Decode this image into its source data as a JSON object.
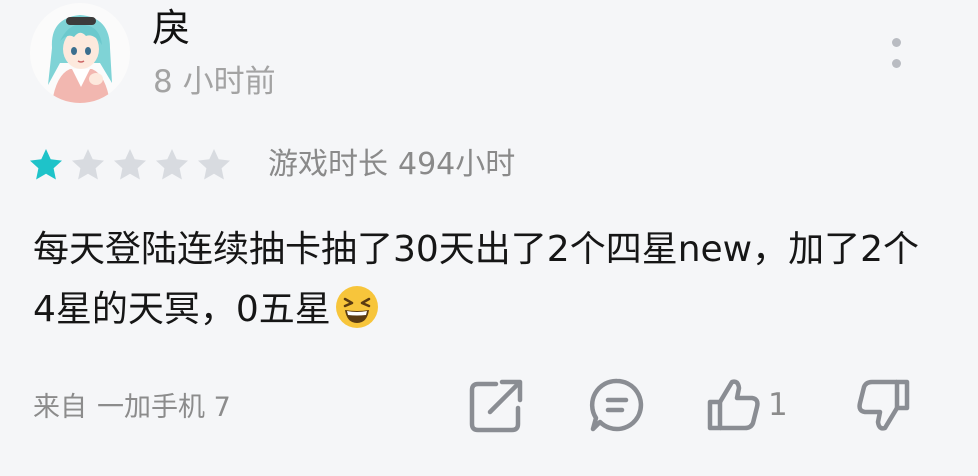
{
  "user": {
    "name": "戾",
    "time_ago": "8 小时前",
    "avatar_icon": "anime-girl-avatar"
  },
  "rating": {
    "stars": 1,
    "max": 5,
    "filled_color": "#1ec3c9",
    "empty_color": "#d8dbe0"
  },
  "playtime": {
    "label": "游戏时长",
    "value": "494小时"
  },
  "review": {
    "text": "每天登陆连续抽卡抽了30天出了2个四星new，加了2个4星的天冥，0五星",
    "emoji": "grinning-squint-emoji"
  },
  "device": {
    "prefix": "来自",
    "name": "一加手机 7"
  },
  "actions": {
    "share_icon": "share-icon",
    "comment_icon": "comment-icon",
    "like_icon": "thumbs-up-icon",
    "like_count": "1",
    "dislike_icon": "thumbs-down-icon"
  }
}
